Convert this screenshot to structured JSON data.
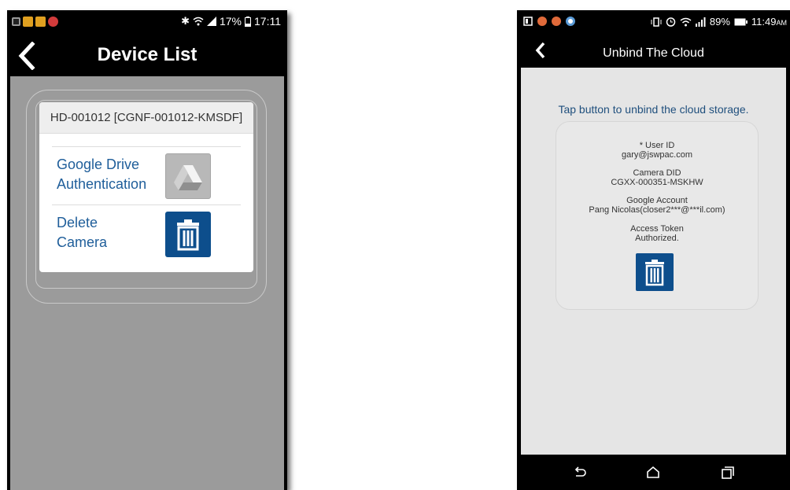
{
  "left_phone": {
    "status": {
      "notification_icons": [
        "gallery-icon",
        "photo-icon",
        "photo-icon",
        "alert-icon"
      ],
      "time": "17:11",
      "battery": "17%"
    },
    "title": "Device List",
    "device_name": "HD-001012 [CGNF-001012-KMSDF]",
    "rows": [
      {
        "label_line1": "Google Drive",
        "label_line2": "Authentication",
        "icon": "google-drive-icon"
      },
      {
        "label_line1": "Delete",
        "label_line2": "Camera",
        "icon": "trash-icon"
      }
    ]
  },
  "right_phone": {
    "status": {
      "time": "11:49",
      "ampm": "AM",
      "battery": "89%"
    },
    "title": "Unbind The Cloud",
    "prompt": "Tap button to unbind the cloud storage.",
    "fields": [
      {
        "label": "* User ID",
        "value": "gary@jswpac.com"
      },
      {
        "label": "Camera DID",
        "value": "CGXX-000351-MSKHW"
      },
      {
        "label": "Google Account",
        "value": "Pang Nicolas(closer2***@***il.com)"
      },
      {
        "label": "Access Token",
        "value": "Authorized."
      }
    ]
  },
  "colors": {
    "link_blue": "#1f5e9a",
    "button_blue": "#0d4e8c",
    "prompt_blue": "#1f4f7d",
    "content_gray": "#9b9b9b",
    "right_bg": "#e5e5e5"
  }
}
